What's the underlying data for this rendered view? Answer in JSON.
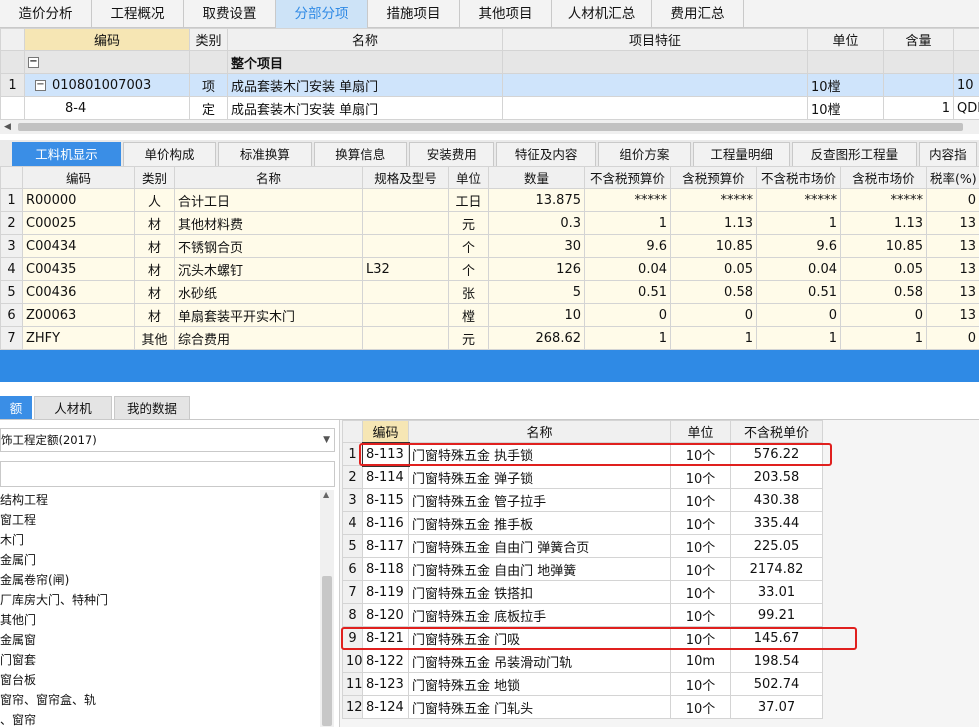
{
  "top_tabs": [
    {
      "label": "造价分析"
    },
    {
      "label": "工程概况"
    },
    {
      "label": "取费设置"
    },
    {
      "label": "分部分项",
      "active": true
    },
    {
      "label": "措施项目"
    },
    {
      "label": "其他项目"
    },
    {
      "label": "人材机汇总"
    },
    {
      "label": "费用汇总"
    }
  ],
  "items_table": {
    "headers": [
      "编码",
      "类别",
      "名称",
      "项目特征",
      "单位",
      "含量",
      ""
    ],
    "group": {
      "expander": "−",
      "label": "整个项目"
    },
    "rows": [
      {
        "no": "1",
        "expander": "−",
        "code": "010801007003",
        "type": "项",
        "name": "成品套装木门安装 单扇门",
        "feature": "",
        "unit": "10樘",
        "qty": "",
        "extra": "10"
      },
      {
        "no": "",
        "expander": "",
        "code": "8-4",
        "type": "定",
        "name": "成品套装木门安装 单扇门",
        "feature": "",
        "unit": "10樘",
        "qty": "1",
        "extra": "QDL"
      }
    ]
  },
  "detail_tabs": [
    {
      "label": "工料机显示",
      "active": true
    },
    {
      "label": "单价构成"
    },
    {
      "label": "标准换算"
    },
    {
      "label": "换算信息"
    },
    {
      "label": "安装费用"
    },
    {
      "label": "特征及内容"
    },
    {
      "label": "组价方案"
    },
    {
      "label": "工程量明细"
    },
    {
      "label": "反查图形工程量"
    },
    {
      "label": "内容指"
    }
  ],
  "material_table": {
    "headers": [
      "",
      "编码",
      "类别",
      "名称",
      "规格及型号",
      "单位",
      "数量",
      "不含税预算价",
      "含税预算价",
      "不含税市场价",
      "含税市场价",
      "税率(%)"
    ],
    "rows": [
      [
        "1",
        "R00000",
        "人",
        "合计工日",
        "",
        "工日",
        "13.875",
        "*****",
        "*****",
        "*****",
        "*****",
        "0"
      ],
      [
        "2",
        "C00025",
        "材",
        "其他材料费",
        "",
        "元",
        "0.3",
        "1",
        "1.13",
        "1",
        "1.13",
        "13"
      ],
      [
        "3",
        "C00434",
        "材",
        "不锈钢合页",
        "",
        "个",
        "30",
        "9.6",
        "10.85",
        "9.6",
        "10.85",
        "13"
      ],
      [
        "4",
        "C00435",
        "材",
        "沉头木螺钉",
        "L32",
        "个",
        "126",
        "0.04",
        "0.05",
        "0.04",
        "0.05",
        "13"
      ],
      [
        "5",
        "C00436",
        "材",
        "水砂纸",
        "",
        "张",
        "5",
        "0.51",
        "0.58",
        "0.51",
        "0.58",
        "13"
      ],
      [
        "6",
        "Z00063",
        "材",
        "单扇套装平开实木门",
        "",
        "樘",
        "10",
        "0",
        "0",
        "0",
        "0",
        "13"
      ],
      [
        "7",
        "ZHFY",
        "其他",
        "综合费用",
        "",
        "元",
        "268.62",
        "1",
        "1",
        "1",
        "1",
        "0"
      ]
    ]
  },
  "lower_tabs": [
    {
      "label": "额",
      "active": true
    },
    {
      "label": "人材机"
    },
    {
      "label": "我的数据"
    }
  ],
  "library": {
    "selected": "饰工程定额(2017)",
    "search_placeholder": ""
  },
  "tree_items": [
    "结构工程",
    "窗工程",
    "木门",
    "金属门",
    "金属卷帘(闸)",
    "厂库房大门、特种门",
    "其他门",
    "金属窗",
    "门窗套",
    "窗台板",
    "窗帘、窗帘盒、轨",
    "、窗帘"
  ],
  "quota_table": {
    "headers": [
      "",
      "编码",
      "名称",
      "单位",
      "不含税单价"
    ],
    "rows": [
      [
        "1",
        "8-113",
        "门窗特殊五金 执手锁",
        "10个",
        "576.22"
      ],
      [
        "2",
        "8-114",
        "门窗特殊五金 弹子锁",
        "10个",
        "203.58"
      ],
      [
        "3",
        "8-115",
        "门窗特殊五金 管子拉手",
        "10个",
        "430.38"
      ],
      [
        "4",
        "8-116",
        "门窗特殊五金 推手板",
        "10个",
        "335.44"
      ],
      [
        "5",
        "8-117",
        "门窗特殊五金 自由门 弹簧合页",
        "10个",
        "225.05"
      ],
      [
        "6",
        "8-118",
        "门窗特殊五金 自由门 地弹簧",
        "10个",
        "2174.82"
      ],
      [
        "7",
        "8-119",
        "门窗特殊五金 铁搭扣",
        "10个",
        "33.01"
      ],
      [
        "8",
        "8-120",
        "门窗特殊五金 底板拉手",
        "10个",
        "99.21"
      ],
      [
        "9",
        "8-121",
        "门窗特殊五金 门吸",
        "10个",
        "145.67"
      ],
      [
        "10",
        "8-122",
        "门窗特殊五金 吊装滑动门轨",
        "10m",
        "198.54"
      ],
      [
        "11",
        "8-123",
        "门窗特殊五金 地锁",
        "10个",
        "502.74"
      ],
      [
        "12",
        "8-124",
        "门窗特殊五金 门轧头",
        "10个",
        "37.07"
      ]
    ]
  },
  "colors": {
    "accent_blue": "#2f8ae5",
    "highlight_red": "#e0201e",
    "selected_row": "#cfe4fb",
    "material_bg": "#fffbe9"
  }
}
